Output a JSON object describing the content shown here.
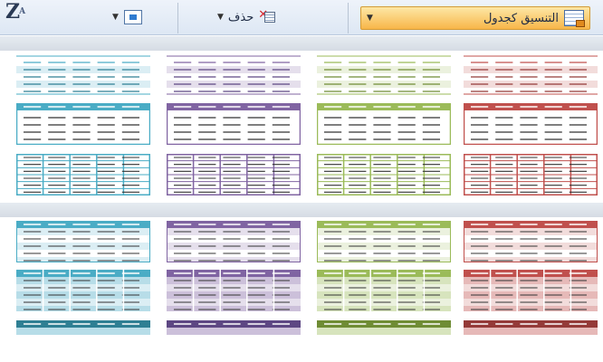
{
  "ribbon": {
    "sort_icon": "sort-za-icon",
    "sort_icon_text": "Z",
    "sort_icon_sub": "A",
    "delete_label": "حذف",
    "format_label": "التنسيق كجدول"
  },
  "gallery": {
    "palette": [
      {
        "name": "teal",
        "border": "#4aacc5",
        "dark": "#2e7f93",
        "light": "#dbeef4",
        "mid": "#b7dde8"
      },
      {
        "name": "purple",
        "border": "#8064a2",
        "dark": "#5d4783",
        "light": "#e5dfec",
        "mid": "#ccc0da"
      },
      {
        "name": "olive",
        "border": "#9bbb59",
        "dark": "#6f8c34",
        "light": "#ebf1de",
        "mid": "#d7e4bd"
      },
      {
        "name": "red",
        "border": "#c0504d",
        "dark": "#943a38",
        "light": "#f2dcdb",
        "mid": "#e6b9b8"
      }
    ],
    "sections": [
      {
        "rows": [
          "light-striped",
          "medium-header",
          "medium-grid"
        ]
      },
      {
        "rows": [
          "medium-banded",
          "medium-block",
          "dark-partial"
        ]
      }
    ]
  }
}
